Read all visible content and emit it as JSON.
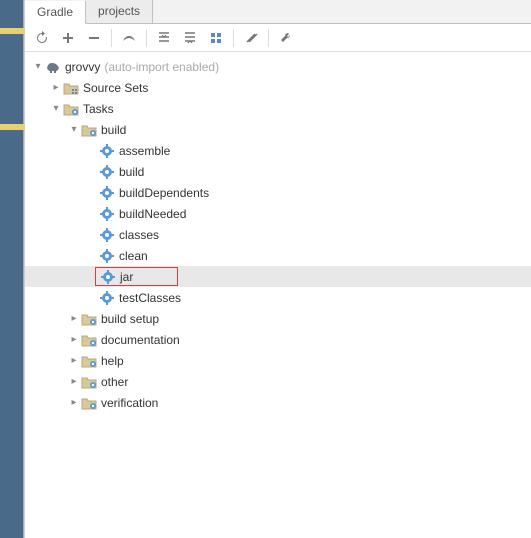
{
  "tabs": {
    "active": "Gradle",
    "other": "projects"
  },
  "toolbar": {
    "refresh": "↻",
    "add": "+",
    "remove": "−",
    "run": "▶",
    "expand": "⇱",
    "collapse": "⇲",
    "group": "▦",
    "offline": "⫽",
    "settings": "🔧"
  },
  "tree": {
    "root": {
      "label": "grovvy",
      "hint": "(auto-import enabled)"
    },
    "sourceSets": "Source Sets",
    "tasks": "Tasks",
    "build": "build",
    "buildTasks": [
      "assemble",
      "build",
      "buildDependents",
      "buildNeeded",
      "classes",
      "clean",
      "jar",
      "testClasses"
    ],
    "folders": [
      "build setup",
      "documentation",
      "help",
      "other",
      "verification"
    ]
  },
  "icons": {
    "elephant": "elephant-icon",
    "folder": "folder-icon",
    "gear": "gear-icon"
  }
}
